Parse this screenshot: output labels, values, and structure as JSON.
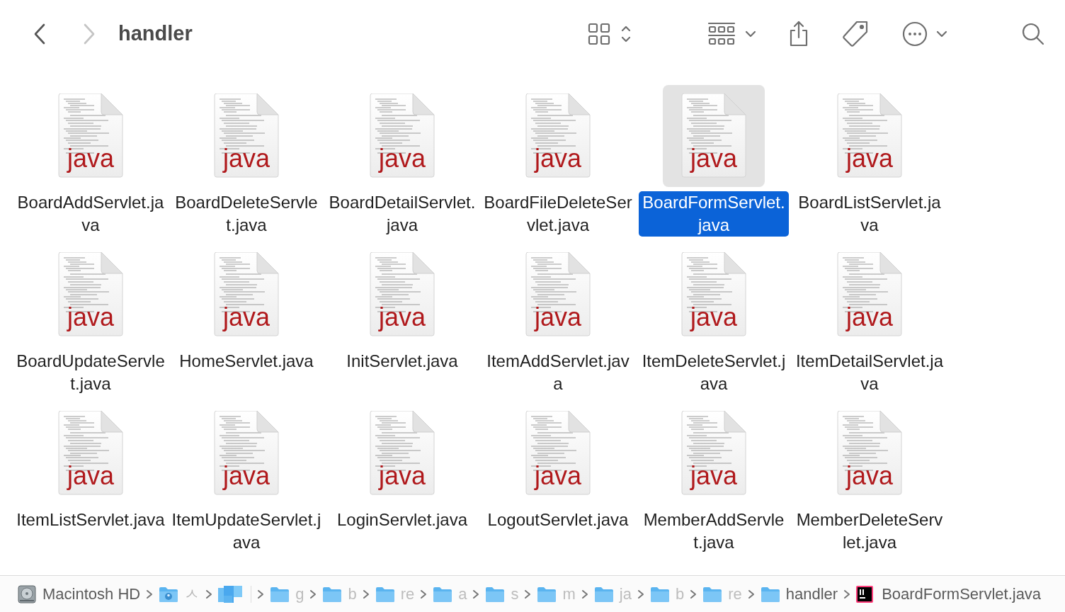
{
  "toolbar": {
    "title": "handler",
    "back_enabled": true,
    "forward_enabled": false
  },
  "files": [
    {
      "name": "BoardAddServlet.java",
      "badge": "java",
      "selected": false
    },
    {
      "name": "BoardDeleteServlet.java",
      "badge": "java",
      "selected": false
    },
    {
      "name": "BoardDetailServlet.java",
      "badge": "java",
      "selected": false
    },
    {
      "name": "BoardFileDeleteServlet.java",
      "badge": "java",
      "selected": false
    },
    {
      "name": "BoardFormServlet.java",
      "badge": "java",
      "selected": true
    },
    {
      "name": "BoardListServlet.java",
      "badge": "java",
      "selected": false
    },
    {
      "name": "BoardUpdateServlet.java",
      "badge": "java",
      "selected": false
    },
    {
      "name": "HomeServlet.java",
      "badge": "java",
      "selected": false
    },
    {
      "name": "InitServlet.java",
      "badge": "java",
      "selected": false
    },
    {
      "name": "ItemAddServlet.java",
      "badge": "java",
      "selected": false
    },
    {
      "name": "ItemDeleteServlet.java",
      "badge": "java",
      "selected": false
    },
    {
      "name": "ItemDetailServlet.java",
      "badge": "java",
      "selected": false
    },
    {
      "name": "ItemListServlet.java",
      "badge": "java",
      "selected": false
    },
    {
      "name": "ItemUpdateServlet.java",
      "badge": "java",
      "selected": false
    },
    {
      "name": "LoginServlet.java",
      "badge": "java",
      "selected": false
    },
    {
      "name": "LogoutServlet.java",
      "badge": "java",
      "selected": false
    },
    {
      "name": "MemberAddServlet.java",
      "badge": "java",
      "selected": false
    },
    {
      "name": "MemberDeleteServlet.java",
      "badge": "java",
      "selected": false
    }
  ],
  "path_bar": [
    {
      "kind": "disk",
      "label": "Macintosh HD"
    },
    {
      "kind": "home",
      "label": "ㅅ"
    },
    {
      "kind": "redacted"
    },
    {
      "kind": "folder",
      "label": "g"
    },
    {
      "kind": "folder",
      "label": "b"
    },
    {
      "kind": "folder",
      "label": "re"
    },
    {
      "kind": "folder",
      "label": "a"
    },
    {
      "kind": "folder",
      "label": "s"
    },
    {
      "kind": "folder",
      "label": "m"
    },
    {
      "kind": "folder",
      "label": "ja"
    },
    {
      "kind": "folder",
      "label": "b"
    },
    {
      "kind": "folder",
      "label": "re"
    },
    {
      "kind": "folder",
      "label": "handler"
    },
    {
      "kind": "file",
      "label": "BoardFormServlet.java"
    }
  ]
}
